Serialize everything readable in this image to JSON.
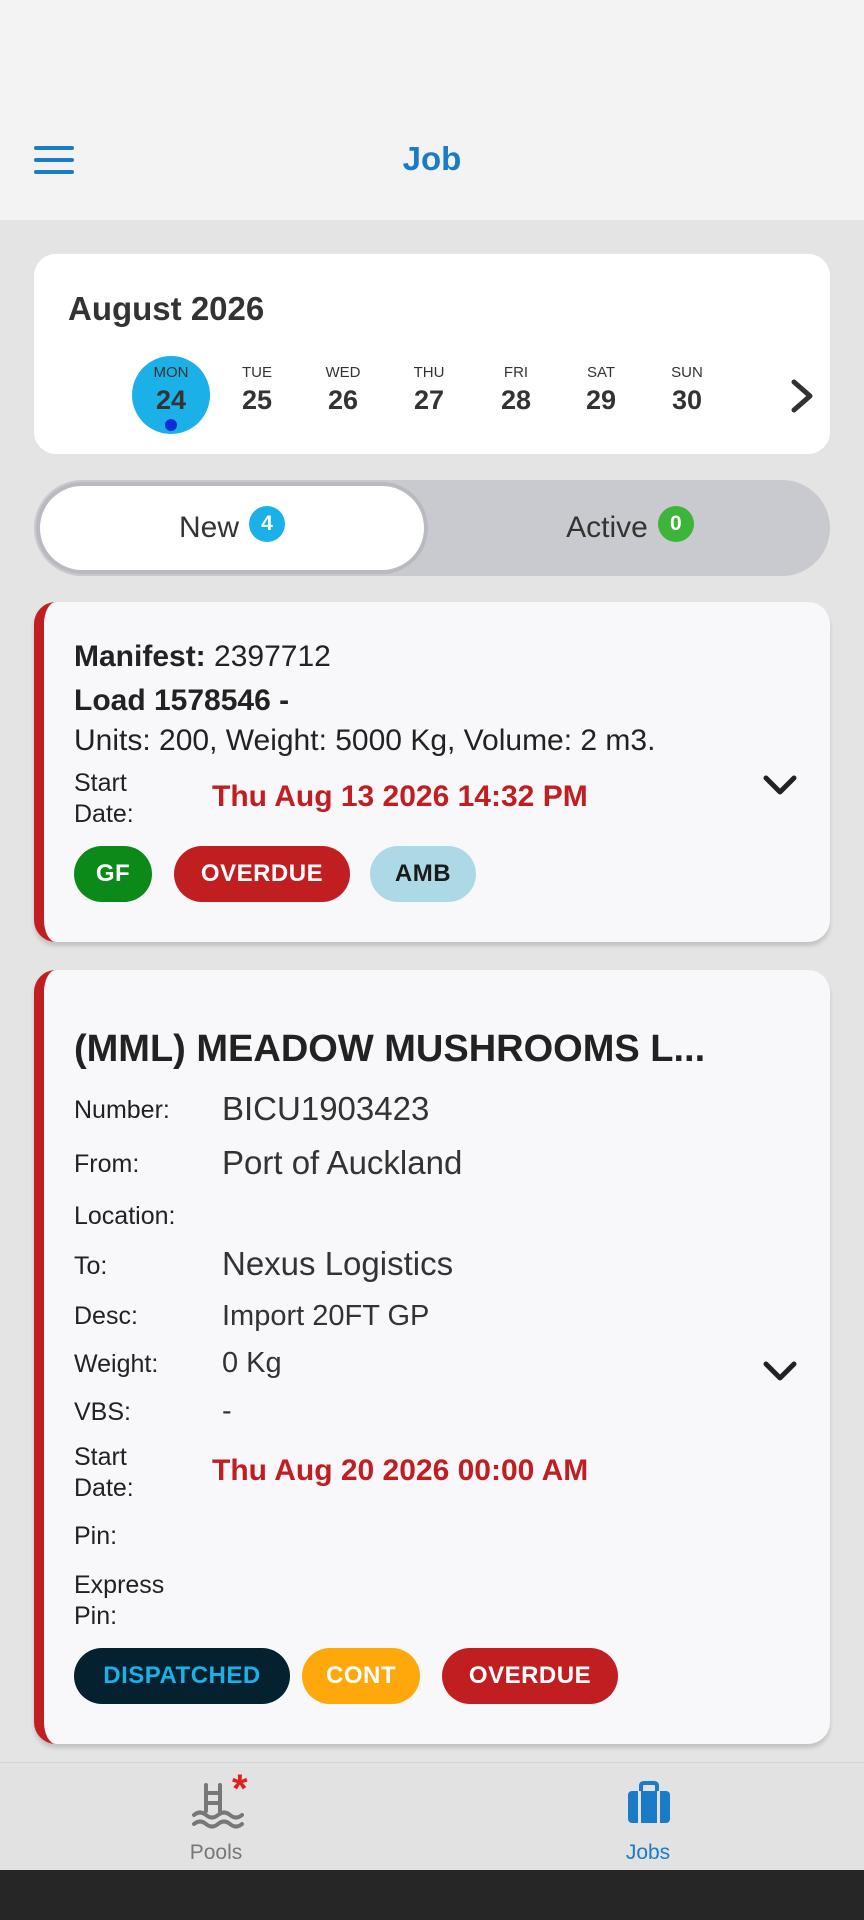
{
  "header": {
    "title": "Job",
    "menu_icon": "hamburger-menu-icon"
  },
  "calendar": {
    "month": "August 2026",
    "days": [
      {
        "name": "MON",
        "num": "24",
        "selected": true,
        "has_jobs": true
      },
      {
        "name": "TUE",
        "num": "25"
      },
      {
        "name": "WED",
        "num": "26"
      },
      {
        "name": "THU",
        "num": "27"
      },
      {
        "name": "FRI",
        "num": "28"
      },
      {
        "name": "SAT",
        "num": "29"
      },
      {
        "name": "SUN",
        "num": "30"
      }
    ],
    "next_icon": "chevron-right-icon"
  },
  "tabs": [
    {
      "label": "New",
      "count": "4",
      "badge_color": "#1bb0e8",
      "active": true
    },
    {
      "label": "Active",
      "count": "0",
      "badge_color": "#3cb53a",
      "active": false
    }
  ],
  "job1": {
    "manifest_label": "Manifest:",
    "manifest_value": "2397712",
    "load": "Load 1578546 -",
    "units": "Units: 200, Weight: 5000 Kg, Volume: 2 m3.",
    "start_label": "Start Date:",
    "start_value": "Thu Aug 13 2026 14:32 PM",
    "chips": [
      {
        "label": "GF",
        "bg": "#0b8a1a",
        "fg": "#ffffff"
      },
      {
        "label": "OVERDUE",
        "bg": "#c11e22",
        "fg": "#ffffff"
      },
      {
        "label": "AMB",
        "bg": "#add8e6",
        "fg": "#1a1a1a"
      }
    ]
  },
  "job2": {
    "title": "(MML) MEADOW MUSHROOMS L...",
    "fields": {
      "number_label": "Number:",
      "number_value": "BICU1903423",
      "from_label": "From:",
      "from_value": "Port of Auckland",
      "location_label": "Location:",
      "to_label": "To:",
      "to_value": "Nexus Logistics",
      "desc_label": "Desc:",
      "desc_value": "Import 20FT GP",
      "weight_label": "Weight:",
      "weight_value": "0 Kg",
      "vbs_label": "VBS:",
      "vbs_value": "-",
      "start_label": "Start Date:",
      "start_value": "Thu Aug 20 2026 00:00 AM",
      "pin_label": "Pin:",
      "express_label": "Express Pin:"
    },
    "chips": [
      {
        "label": "DISPATCHED",
        "bg": "#05202e",
        "fg": "#1bb0e8"
      },
      {
        "label": "CONT",
        "bg": "#ffa80b",
        "fg": "#ffffff"
      },
      {
        "label": "OVERDUE",
        "bg": "#c11e22",
        "fg": "#ffffff"
      }
    ]
  },
  "nav": {
    "pools": {
      "label": "Pools",
      "icon": "pool-icon",
      "color": "#777777",
      "alert": "*"
    },
    "jobs": {
      "label": "Jobs",
      "icon": "briefcase-icon",
      "color": "#1a7bc7"
    }
  }
}
